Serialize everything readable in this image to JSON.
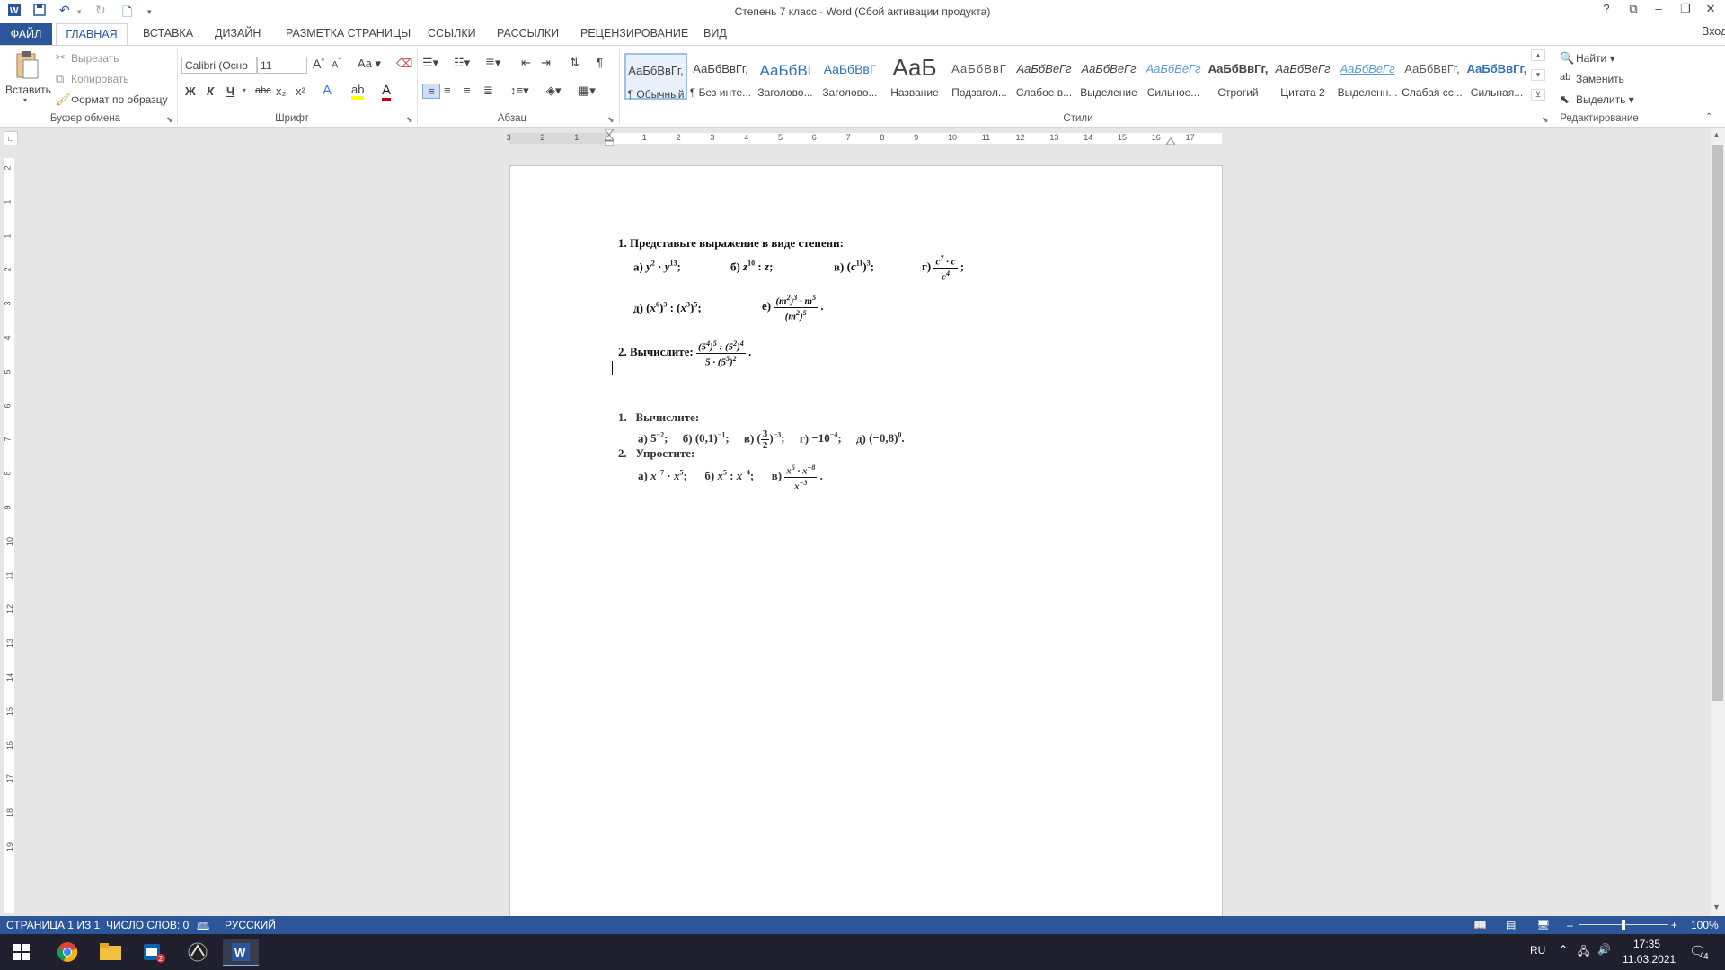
{
  "window": {
    "title": "Степень 7 класс - Word (Сбой активации продукта)",
    "signin": "Вход",
    "help": "?",
    "min": "–",
    "restore": "❐",
    "close": "✕"
  },
  "tabs": [
    "ФАЙЛ",
    "ГЛАВНАЯ",
    "ВСТАВКА",
    "ДИЗАЙН",
    "РАЗМЕТКА СТРАНИЦЫ",
    "ССЫЛКИ",
    "РАССЫЛКИ",
    "РЕЦЕНЗИРОВАНИЕ",
    "ВИД"
  ],
  "clipboard": {
    "paste": "Вставить",
    "cut": "Вырезать",
    "copy": "Копировать",
    "format_painter": "Формат по образцу",
    "label": "Буфер обмена"
  },
  "font": {
    "name": "Calibri (Осно",
    "size": "11",
    "label": "Шрифт",
    "bold": "Ж",
    "italic": "К",
    "underline": "Ч",
    "strike": "abc",
    "sub": "x₂",
    "sup": "x²",
    "case": "Aa",
    "grow": "A",
    "shrink": "A"
  },
  "paragraph": {
    "label": "Абзац"
  },
  "styles": {
    "label": "Стили",
    "items": [
      {
        "sample": "АаБбВвГг,",
        "name": "¶ Обычный"
      },
      {
        "sample": "АаБбВвГг,",
        "name": "¶ Без инте..."
      },
      {
        "sample": "АаБбВі",
        "name": "Заголово..."
      },
      {
        "sample": "АаБбВвГ",
        "name": "Заголово..."
      },
      {
        "sample": "АаБ",
        "name": "Название"
      },
      {
        "sample": "АаБбВвГ",
        "name": "Подзагол..."
      },
      {
        "sample": "АаБбВеГг",
        "name": "Слабое в..."
      },
      {
        "sample": "АаБбВеГг",
        "name": "Выделение"
      },
      {
        "sample": "АаБбВеГг",
        "name": "Сильное..."
      },
      {
        "sample": "АаБбВвГг,",
        "name": "Строгий"
      },
      {
        "sample": "АаБбВеГг",
        "name": "Цитата 2"
      },
      {
        "sample": "АаБбВеГг",
        "name": "Выделенн..."
      },
      {
        "sample": "АаБбВвГг,",
        "name": "Слабая сс..."
      },
      {
        "sample": "АаБбВвГг,",
        "name": "Сильная..."
      }
    ]
  },
  "editing": {
    "label": "Редактирование",
    "find": "Найти",
    "replace": "Заменить",
    "select": "Выделить"
  },
  "ruler": {
    "left": [
      "3",
      "2",
      "1"
    ],
    "right": [
      "1",
      "2",
      "3",
      "4",
      "5",
      "6",
      "7",
      "8",
      "9",
      "10",
      "11",
      "12",
      "13",
      "14",
      "15",
      "16",
      "17"
    ],
    "vertical": [
      "2",
      "1",
      "1",
      "2",
      "3",
      "4",
      "5",
      "6",
      "7",
      "8",
      "9",
      "10",
      "11",
      "12",
      "13",
      "14",
      "15",
      "16",
      "17",
      "18",
      "19"
    ]
  },
  "document": {
    "q1_num": "1.",
    "q1_text": "Представьте выражение в виде степени:",
    "q1_a": "а)",
    "q1_b": "б)",
    "q1_v": "в)",
    "q1_g": "г)",
    "q1_d": "д)",
    "q1_e": "е)",
    "q2_num": "2.",
    "q2_text": "Вычислите:",
    "s1_num": "1.",
    "s1_text": "Вычислите:",
    "s1_a": "а)",
    "s1_b": "б)",
    "s1_v": "в)",
    "s1_g": "г)",
    "s1_d": "д)",
    "s2_num": "2.",
    "s2_text": "Упростите:",
    "s2_a": "а)",
    "s2_b": "б)",
    "s2_v": "в)"
  },
  "status": {
    "page": "СТРАНИЦА 1 ИЗ 1",
    "words": "ЧИСЛО СЛОВ: 0",
    "lang": "РУССКИЙ",
    "zoom": "100%",
    "zoom_level": 0.5
  },
  "taskbar": {
    "lang": "RU",
    "time": "17:35",
    "date": "11.03.2021",
    "notif": "4",
    "badge": "2"
  }
}
